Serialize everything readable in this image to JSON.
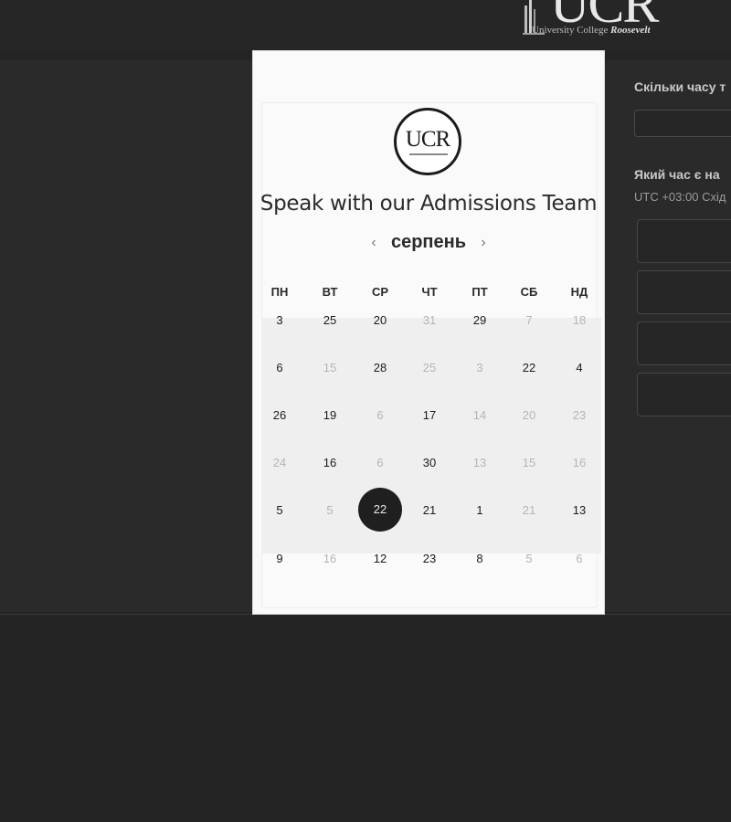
{
  "header": {
    "logo_big": "UCR",
    "logo_sub": "University College ",
    "logo_sub_bold": "Roosevelt"
  },
  "calendar": {
    "logo_text": "UCR",
    "title": "Speak with our Admissions Team",
    "month": "серпень",
    "weekdays": [
      "ПН",
      "ВТ",
      "СР",
      "ЧТ",
      "ПТ",
      "СБ",
      "НД"
    ],
    "weeks": [
      [
        {
          "d": "3"
        },
        {
          "d": "25"
        },
        {
          "d": "20"
        },
        {
          "d": "31",
          "muted": true
        },
        {
          "d": "29"
        },
        {
          "d": "7",
          "muted": true
        },
        {
          "d": "18",
          "muted": true
        }
      ],
      [
        {
          "d": "6"
        },
        {
          "d": "15",
          "muted": true
        },
        {
          "d": "28"
        },
        {
          "d": "25",
          "muted": true
        },
        {
          "d": "3",
          "muted": true
        },
        {
          "d": "22"
        },
        {
          "d": "4"
        }
      ],
      [
        {
          "d": "26"
        },
        {
          "d": "19"
        },
        {
          "d": "6",
          "muted": true
        },
        {
          "d": "17"
        },
        {
          "d": "14",
          "muted": true
        },
        {
          "d": "20",
          "muted": true
        },
        {
          "d": "23",
          "muted": true
        }
      ],
      [
        {
          "d": "24",
          "muted": true
        },
        {
          "d": "16"
        },
        {
          "d": "6",
          "muted": true
        },
        {
          "d": "30"
        },
        {
          "d": "13",
          "muted": true
        },
        {
          "d": "15",
          "muted": true
        },
        {
          "d": "16",
          "muted": true
        }
      ],
      [
        {
          "d": "5"
        },
        {
          "d": "5",
          "muted": true
        },
        {
          "d": "22",
          "selected": true
        },
        {
          "d": "21"
        },
        {
          "d": "1"
        },
        {
          "d": "21",
          "muted": true
        },
        {
          "d": "13"
        }
      ],
      [
        {
          "d": "9"
        },
        {
          "d": "16",
          "muted": true
        },
        {
          "d": "12"
        },
        {
          "d": "23"
        },
        {
          "d": "8"
        },
        {
          "d": "5",
          "muted": true
        },
        {
          "d": "6",
          "muted": true
        }
      ]
    ]
  },
  "form": {
    "duration_question": "Скільки часу т",
    "time_question": "Який час є на",
    "timezone": "UTC +03:00 Схід",
    "slot_count": 4
  },
  "colors": {
    "page_bg": "#242424",
    "card_bg": "#fafafa",
    "selected_day": "#1f1f1f"
  }
}
